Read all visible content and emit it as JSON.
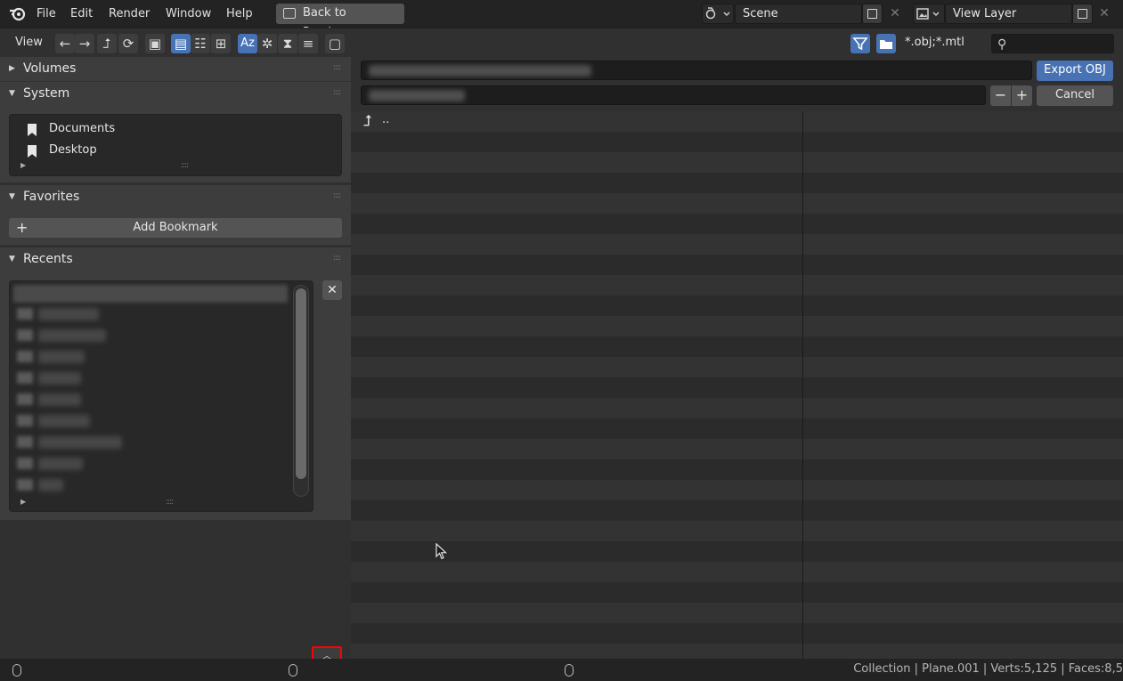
{
  "menubar": {
    "items": [
      "File",
      "Edit",
      "Render",
      "Window",
      "Help"
    ],
    "back_button": "Back to Previous",
    "scene": "Scene",
    "view_layer": "View Layer"
  },
  "toolbar": {
    "view_label": "View",
    "filter_text": "*.obj;*.mtl",
    "search_placeholder": "",
    "sort_label": "Az"
  },
  "sidebar": {
    "sections": {
      "volumes": "Volumes",
      "system": "System",
      "favorites": "Favorites",
      "recents": "Recents"
    },
    "system_items": [
      "Documents",
      "Desktop"
    ],
    "add_bookmark": "Add Bookmark"
  },
  "main": {
    "export_button": "Export OBJ",
    "cancel_button": "Cancel",
    "parent_dir": ".."
  },
  "status": {
    "text": "Collection | Plane.001 | Verts:5,125 | Faces:8,5"
  },
  "colors": {
    "accent": "#4772b3",
    "highlight_box": "#ff0000"
  }
}
